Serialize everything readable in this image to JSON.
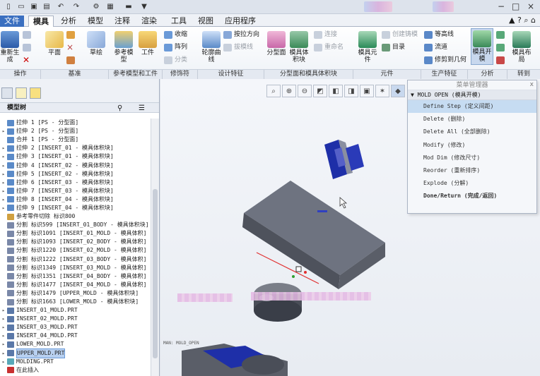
{
  "quick_access": {
    "dropdown": "▼"
  },
  "tabs": [
    "文件",
    "模具",
    "分析",
    "模型",
    "注释",
    "渲染",
    "工具",
    "视图",
    "应用程序"
  ],
  "ribbon": {
    "large": [
      {
        "label": "重新生成"
      },
      {
        "label": "平面"
      },
      {
        "label": "草绘"
      },
      {
        "label": "参考模型"
      },
      {
        "label": "工件"
      },
      {
        "label": "轮廓曲线"
      },
      {
        "label": "分型面"
      },
      {
        "label": "模具体积块"
      },
      {
        "label": "模具元件"
      },
      {
        "label": "模具开模"
      },
      {
        "label": "模具布局"
      }
    ],
    "small": {
      "shrink": "收缩",
      "pattern": "阵列",
      "split": "分类",
      "extrude_dir": "按拉方向",
      "drag_line": "拔模线",
      "connect": "连接",
      "rename": "重命名",
      "create_casting": "创建铸模",
      "catalog": "目录",
      "contour": "等高线",
      "flow": "流道",
      "trim_geom": "修剪到几何"
    },
    "groups": [
      "操作",
      "基准",
      "参考模型和工件",
      "修饰符",
      "设计特征",
      "分型面和模具体积块",
      "元件",
      "生产特征",
      "分析",
      "转到"
    ]
  },
  "model_tree": {
    "title": "模型树",
    "rows": [
      {
        "label": "拉伸 1 [PS - 分型面]",
        "exp": "",
        "type": "feat"
      },
      {
        "label": "拉伸 2 [PS - 分型面]",
        "exp": "▸",
        "type": "feat"
      },
      {
        "label": "合并 1 [PS - 分型面]",
        "exp": "",
        "type": "feat"
      },
      {
        "label": "拉伸 2 [INSERT_01 - 模具体积块]",
        "exp": "▸",
        "type": "feat"
      },
      {
        "label": "拉伸 3 [INSERT_01 - 模具体积块]",
        "exp": "▸",
        "type": "feat"
      },
      {
        "label": "拉伸 4 [INSERT_02 - 模具体积块]",
        "exp": "▸",
        "type": "feat"
      },
      {
        "label": "拉伸 5 [INSERT_02 - 模具体积块]",
        "exp": "▸",
        "type": "feat"
      },
      {
        "label": "拉伸 6 [INSERT_03 - 模具体积块]",
        "exp": "▸",
        "type": "feat"
      },
      {
        "label": "拉伸 7 [INSERT_03 - 模具体积块]",
        "exp": "▸",
        "type": "feat"
      },
      {
        "label": "拉伸 8 [INSERT_04 - 模具体积块]",
        "exp": "▸",
        "type": "feat"
      },
      {
        "label": "拉伸 9 [INSERT_04 - 模具体积块]",
        "exp": "▸",
        "type": "feat"
      },
      {
        "label": "参考零件切除 标识800",
        "exp": "",
        "type": "cut"
      },
      {
        "label": "分割 标识599 [INSERT_01_BODY - 模具体积块]",
        "exp": "",
        "type": "split"
      },
      {
        "label": "分割 标识1091 [INSERT_01_MOLD - 模具体积]",
        "exp": "",
        "type": "split"
      },
      {
        "label": "分割 标识1093 [INSERT_02_BODY - 模具体积]",
        "exp": "",
        "type": "split"
      },
      {
        "label": "分割 标识1220 [INSERT_02_MOLD - 模具体积]",
        "exp": "",
        "type": "split"
      },
      {
        "label": "分割 标识1222 [INSERT_03_BODY - 模具体积]",
        "exp": "",
        "type": "split"
      },
      {
        "label": "分割 标识1349 [INSERT_03_MOLD - 模具体积]",
        "exp": "",
        "type": "split"
      },
      {
        "label": "分割 标识1351 [INSERT_04_BODY - 模具体积]",
        "exp": "",
        "type": "split"
      },
      {
        "label": "分割 标识1477 [INSERT_04_MOLD - 模具体积]",
        "exp": "",
        "type": "split"
      },
      {
        "label": "分割 标识1479 [UPPER_MOLD - 模具体积块]",
        "exp": "",
        "type": "split"
      },
      {
        "label": "分割 标识1663 [LOWER_MOLD - 模具体积块]",
        "exp": "",
        "type": "split"
      },
      {
        "label": "INSERT_01_MOLD.PRT",
        "exp": "▸",
        "type": "part"
      },
      {
        "label": "INSERT_02_MOLD.PRT",
        "exp": "▸",
        "type": "part"
      },
      {
        "label": "INSERT_03_MOLD.PRT",
        "exp": "▸",
        "type": "part"
      },
      {
        "label": "INSERT_04_MOLD.PRT",
        "exp": "▸",
        "type": "part"
      },
      {
        "label": "LOWER_MOLD.PRT",
        "exp": "▸",
        "type": "part"
      },
      {
        "label": "UPPER_MOLD.PRT",
        "exp": "▸",
        "type": "part",
        "selected": true
      },
      {
        "label": "MOLDING.PRT",
        "exp": "▸",
        "type": "molding"
      },
      {
        "label": "在此插入",
        "exp": "",
        "type": "insert"
      }
    ]
  },
  "menu_manager": {
    "title": "菜单管理器",
    "close": "x",
    "submenu": "MOLD OPEN (模具开模)",
    "items": [
      {
        "label": "Define Step (定义间距)",
        "highlight": true
      },
      {
        "label": "Delete (删除)"
      },
      {
        "label": "Delete All (全部删除)"
      },
      {
        "label": "Modify (修改)"
      },
      {
        "label": "Mod Dim (修改尺寸)"
      },
      {
        "label": "Reorder (重新排序)"
      },
      {
        "label": "Explode (分解)"
      },
      {
        "label": "Done/Return (完成/返回)",
        "bold": true
      }
    ]
  },
  "graphics": {
    "model_label": "MAN: MOLD_OPEN"
  },
  "colors": {
    "accent": "#3a6fc0",
    "mold_blue": "#1e2fa8",
    "mold_gray": "#6e7380",
    "axis_red": "#e03030"
  }
}
